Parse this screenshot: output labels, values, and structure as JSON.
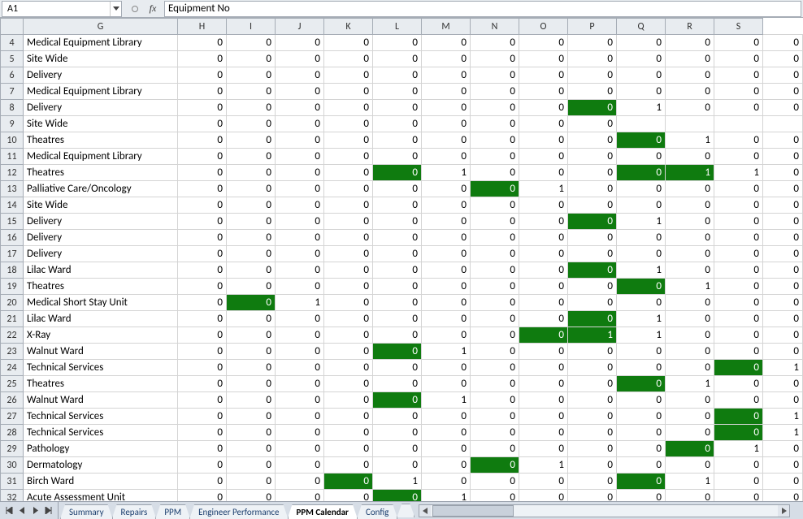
{
  "name_box": "A1",
  "formula_value": "Equipment No",
  "columns": [
    "G",
    "H",
    "I",
    "J",
    "K",
    "L",
    "M",
    "N",
    "O",
    "P",
    "Q",
    "R",
    "S"
  ],
  "rows": [
    {
      "n": 4,
      "label": "Medical Equipment Library",
      "v": [
        0,
        0,
        0,
        0,
        0,
        0,
        0,
        0,
        0,
        0,
        0,
        0,
        0
      ],
      "hl": []
    },
    {
      "n": 5,
      "label": "Site Wide",
      "v": [
        0,
        0,
        0,
        0,
        0,
        0,
        0,
        0,
        0,
        0,
        0,
        0,
        0
      ],
      "hl": []
    },
    {
      "n": 6,
      "label": "Delivery",
      "v": [
        0,
        0,
        0,
        0,
        0,
        0,
        0,
        0,
        0,
        0,
        0,
        0,
        0
      ],
      "hl": []
    },
    {
      "n": 7,
      "label": "Medical Equipment Library",
      "v": [
        0,
        0,
        0,
        0,
        0,
        0,
        0,
        0,
        0,
        0,
        0,
        0,
        0
      ],
      "hl": []
    },
    {
      "n": 8,
      "label": "Delivery",
      "v": [
        0,
        0,
        0,
        0,
        0,
        0,
        0,
        0,
        0,
        1,
        0,
        0,
        0
      ],
      "hl": [
        9
      ]
    },
    {
      "n": 9,
      "label": "Site Wide",
      "v": [
        0,
        0,
        0,
        0,
        0,
        0,
        0,
        0,
        0,
        "",
        "",
        "",
        ""
      ],
      "hl": []
    },
    {
      "n": 10,
      "label": "Theatres",
      "v": [
        0,
        0,
        0,
        0,
        0,
        0,
        0,
        0,
        0,
        0,
        1,
        0,
        0
      ],
      "hl": [
        10
      ]
    },
    {
      "n": 11,
      "label": "Medical Equipment Library",
      "v": [
        0,
        0,
        0,
        0,
        0,
        0,
        0,
        0,
        0,
        0,
        0,
        0,
        0
      ],
      "hl": []
    },
    {
      "n": 12,
      "label": "Theatres",
      "v": [
        0,
        0,
        0,
        0,
        0,
        1,
        0,
        0,
        0,
        0,
        1,
        1,
        0
      ],
      "hl": [
        5,
        10,
        11
      ]
    },
    {
      "n": 13,
      "label": "Palliative Care/Oncology",
      "v": [
        0,
        0,
        0,
        0,
        0,
        0,
        0,
        1,
        0,
        0,
        0,
        0,
        0
      ],
      "hl": [
        7
      ]
    },
    {
      "n": 14,
      "label": "Site Wide",
      "v": [
        0,
        0,
        0,
        0,
        0,
        0,
        0,
        0,
        0,
        0,
        0,
        0,
        0
      ],
      "hl": []
    },
    {
      "n": 15,
      "label": "Delivery",
      "v": [
        0,
        0,
        0,
        0,
        0,
        0,
        0,
        0,
        0,
        1,
        0,
        0,
        0
      ],
      "hl": [
        9
      ]
    },
    {
      "n": 16,
      "label": "Delivery",
      "v": [
        0,
        0,
        0,
        0,
        0,
        0,
        0,
        0,
        0,
        0,
        0,
        0,
        0
      ],
      "hl": []
    },
    {
      "n": 17,
      "label": "Delivery",
      "v": [
        0,
        0,
        0,
        0,
        0,
        0,
        0,
        0,
        0,
        0,
        0,
        0,
        0
      ],
      "hl": []
    },
    {
      "n": 18,
      "label": "Lilac Ward",
      "v": [
        0,
        0,
        0,
        0,
        0,
        0,
        0,
        0,
        0,
        1,
        0,
        0,
        0
      ],
      "hl": [
        9
      ]
    },
    {
      "n": 19,
      "label": "Theatres",
      "v": [
        0,
        0,
        0,
        0,
        0,
        0,
        0,
        0,
        0,
        0,
        1,
        0,
        0
      ],
      "hl": [
        10
      ]
    },
    {
      "n": 20,
      "label": "Medical Short Stay Unit",
      "v": [
        0,
        0,
        1,
        0,
        0,
        0,
        0,
        0,
        0,
        0,
        0,
        0,
        0
      ],
      "hl": [
        2
      ]
    },
    {
      "n": 21,
      "label": "Lilac Ward",
      "v": [
        0,
        0,
        0,
        0,
        0,
        0,
        0,
        0,
        0,
        1,
        0,
        0,
        0
      ],
      "hl": [
        9
      ]
    },
    {
      "n": 22,
      "label": "X-Ray",
      "v": [
        0,
        0,
        0,
        0,
        0,
        0,
        0,
        0,
        1,
        1,
        0,
        0,
        0
      ],
      "hl": [
        8,
        9
      ]
    },
    {
      "n": 23,
      "label": "Walnut Ward",
      "v": [
        0,
        0,
        0,
        0,
        0,
        1,
        0,
        0,
        0,
        0,
        0,
        0,
        0
      ],
      "hl": [
        5
      ]
    },
    {
      "n": 24,
      "label": "Technical Services",
      "v": [
        0,
        0,
        0,
        0,
        0,
        0,
        0,
        0,
        0,
        0,
        0,
        0,
        1
      ],
      "hl": [
        12
      ]
    },
    {
      "n": 25,
      "label": "Theatres",
      "v": [
        0,
        0,
        0,
        0,
        0,
        0,
        0,
        0,
        0,
        0,
        1,
        0,
        0
      ],
      "hl": [
        10
      ]
    },
    {
      "n": 26,
      "label": "Walnut Ward",
      "v": [
        0,
        0,
        0,
        0,
        0,
        1,
        0,
        0,
        0,
        0,
        0,
        0,
        0
      ],
      "hl": [
        5
      ]
    },
    {
      "n": 27,
      "label": "Technical Services",
      "v": [
        0,
        0,
        0,
        0,
        0,
        0,
        0,
        0,
        0,
        0,
        0,
        0,
        1
      ],
      "hl": [
        12
      ]
    },
    {
      "n": 28,
      "label": "Technical Services",
      "v": [
        0,
        0,
        0,
        0,
        0,
        0,
        0,
        0,
        0,
        0,
        0,
        0,
        1
      ],
      "hl": [
        12
      ]
    },
    {
      "n": 29,
      "label": "Pathology",
      "v": [
        0,
        0,
        0,
        0,
        0,
        0,
        0,
        0,
        0,
        0,
        0,
        1,
        0
      ],
      "hl": [
        11
      ]
    },
    {
      "n": 30,
      "label": "Dermatology",
      "v": [
        0,
        0,
        0,
        0,
        0,
        0,
        0,
        1,
        0,
        0,
        0,
        0,
        0
      ],
      "hl": [
        7
      ]
    },
    {
      "n": 31,
      "label": "Birch Ward",
      "v": [
        0,
        0,
        0,
        0,
        1,
        0,
        0,
        0,
        0,
        0,
        1,
        0,
        0
      ],
      "hl": [
        4,
        10
      ]
    },
    {
      "n": 32,
      "label": "Acute Assessment Unit",
      "v": [
        0,
        0,
        0,
        0,
        0,
        1,
        0,
        0,
        0,
        0,
        0,
        0,
        0
      ],
      "hl": [
        5
      ]
    }
  ],
  "sheet_tabs": [
    {
      "label": "Summary",
      "active": false
    },
    {
      "label": "Repairs",
      "active": false
    },
    {
      "label": "PPM",
      "active": false
    },
    {
      "label": "Engineer Performance",
      "active": false
    },
    {
      "label": "PPM Calendar",
      "active": true
    },
    {
      "label": "Config",
      "active": false
    }
  ]
}
